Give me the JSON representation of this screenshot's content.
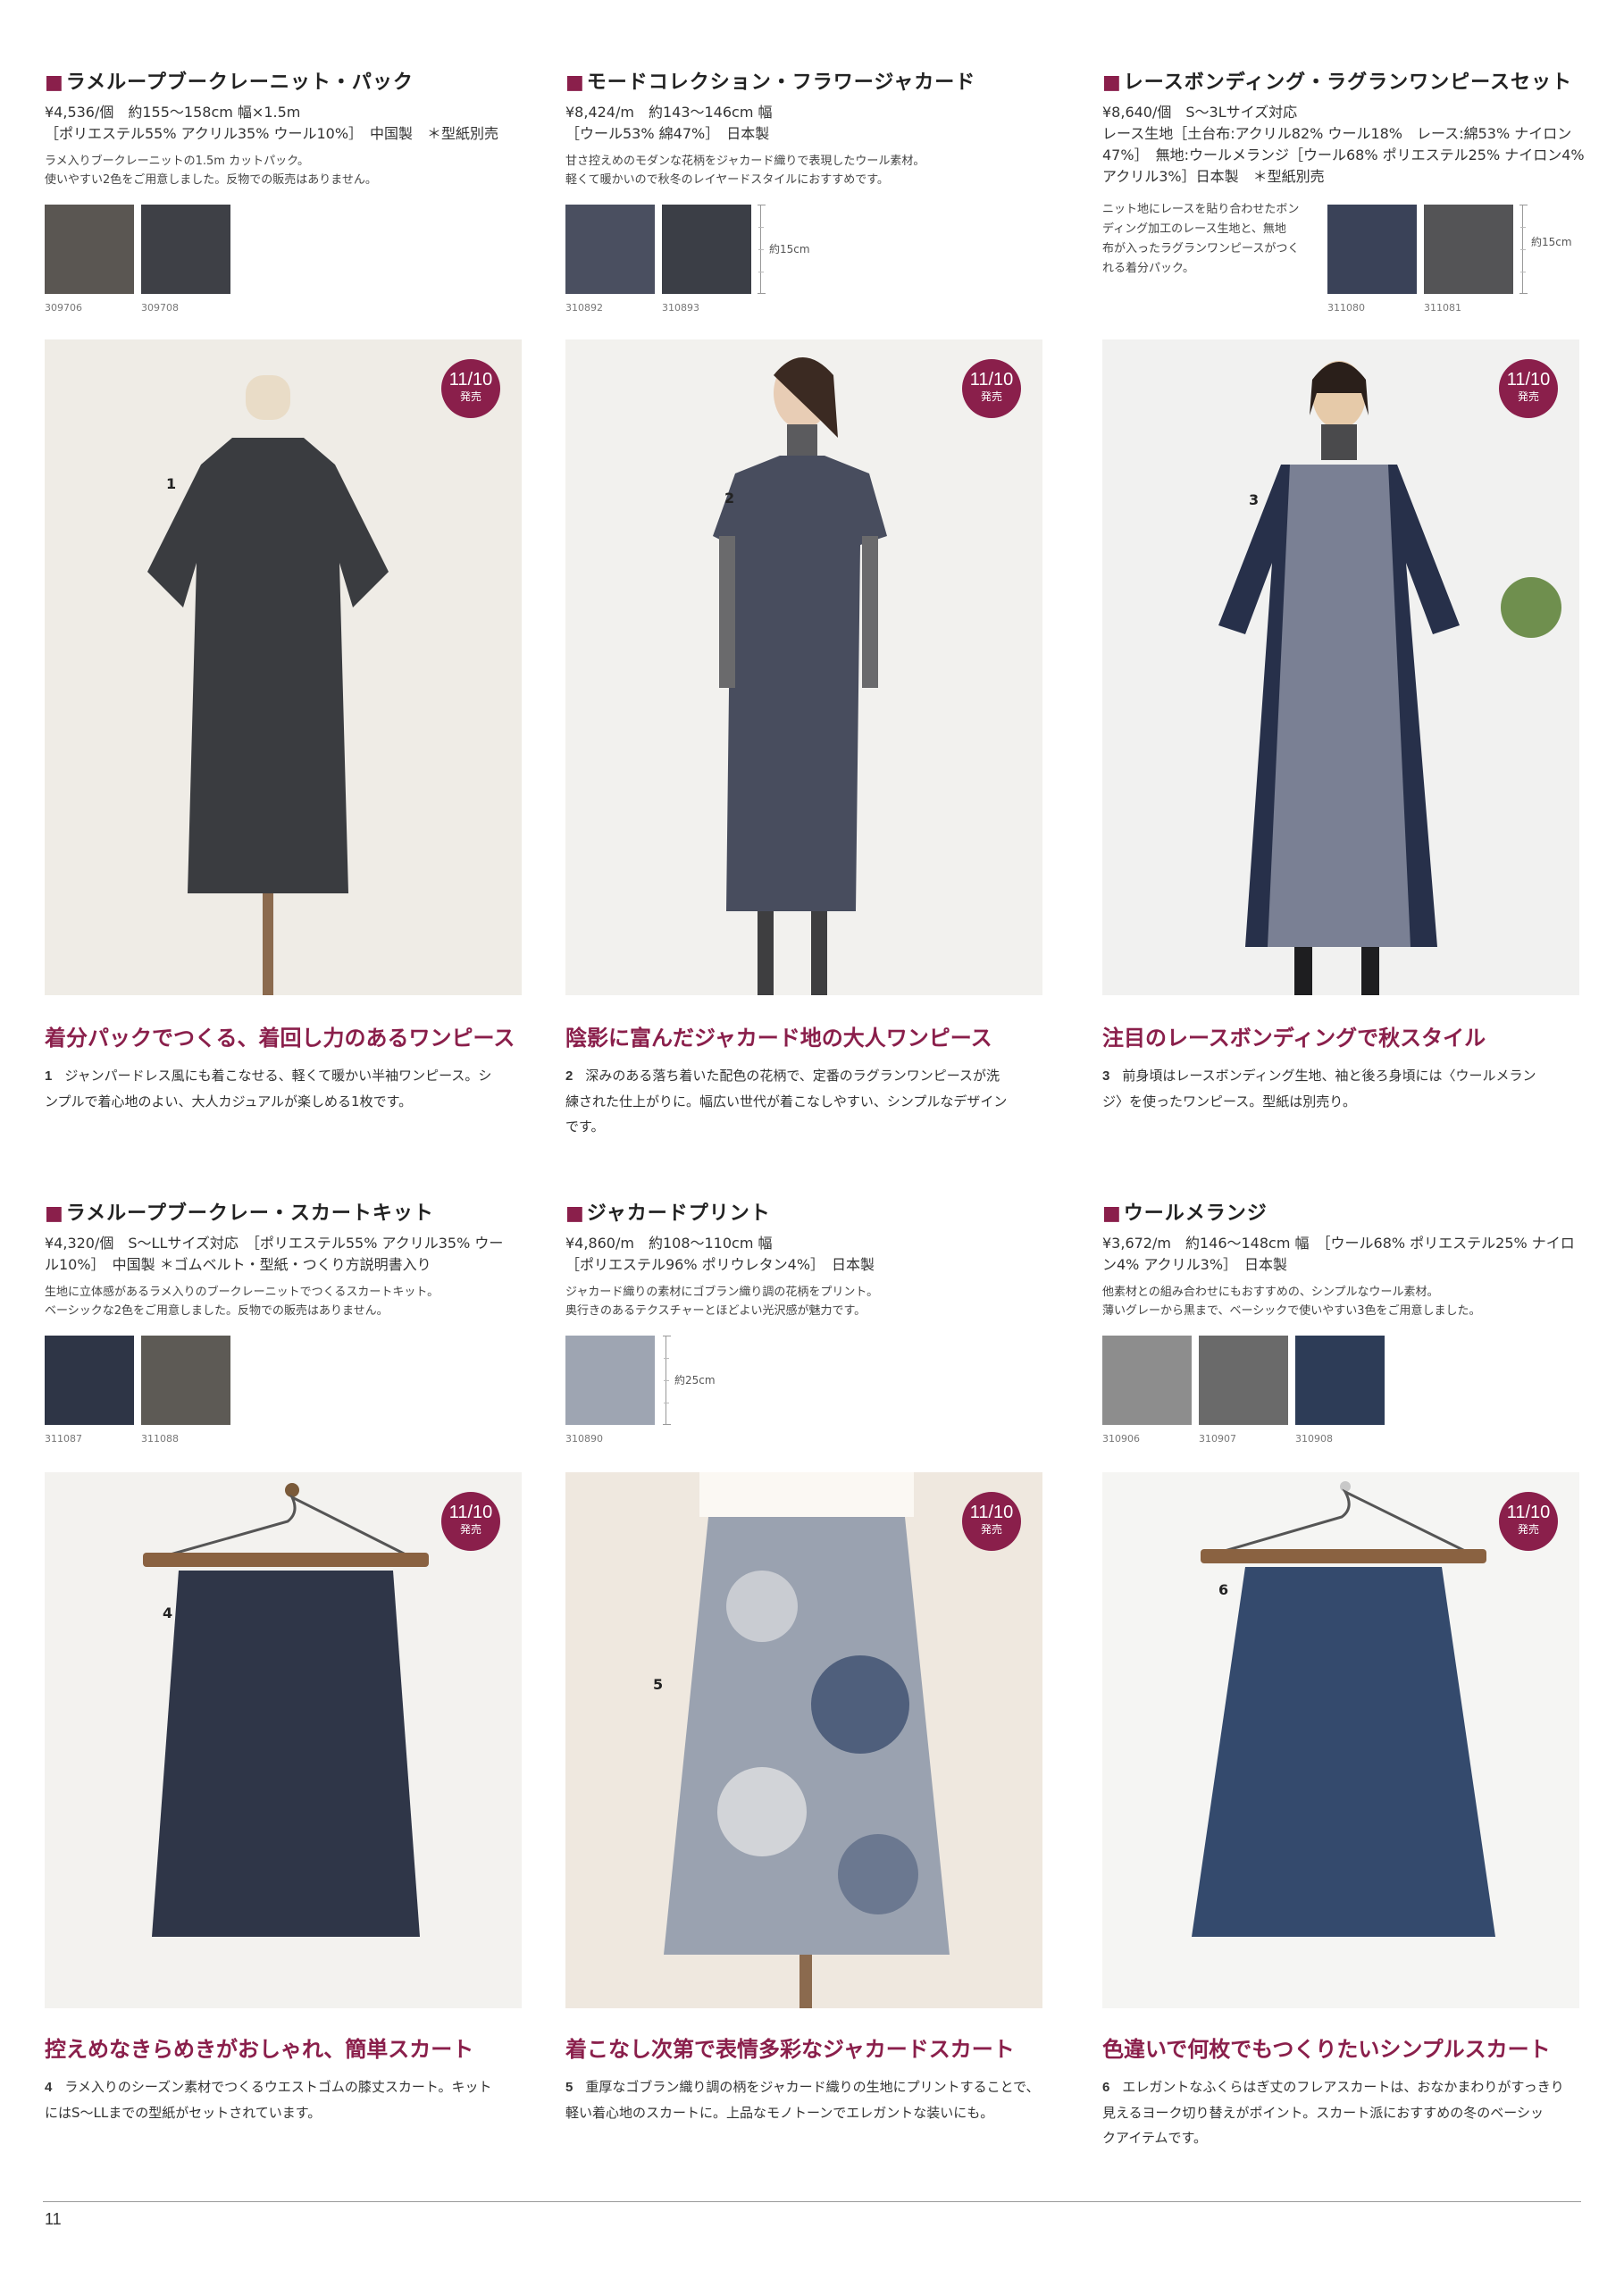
{
  "products": [
    {
      "title": "ラメループブークレーニット・パック",
      "specs": [
        "¥4,536/個　約155～158cm 幅×1.5m",
        "［ポリエステル55% アクリル35% ウール10%］　中国製　＊型紙別売"
      ],
      "desc": [
        "ラメ入りブークレーニットの1.5m カットパック。",
        "使いやすい2色をご用意しました。反物での販売はありません。"
      ],
      "swatches": [
        {
          "code": "309706",
          "color": "#5a5652"
        },
        {
          "code": "309708",
          "color": "#3e4046"
        }
      ],
      "ruler": "",
      "badge": {
        "date": "11/10",
        "label": "発売"
      },
      "photo_number": "1",
      "headline": "着分パックでつくる、着回し力のあるワンピース",
      "caption_number": "1",
      "caption": [
        "ジャンパードレス風にも着こなせる、軽くて暖かい半袖ワンピース。シ",
        "ンプルで着心地のよい、大人カジュアルが楽しめる1枚です。"
      ]
    },
    {
      "title": "モードコレクション・フラワージャカード",
      "specs": [
        "¥8,424/m　約143～146cm 幅",
        "［ウール53% 綿47%］　日本製"
      ],
      "desc": [
        "甘さ控えめのモダンな花柄をジャカード織りで表現したウール素材。",
        "軽くて暖かいので秋冬のレイヤードスタイルにおすすめです。"
      ],
      "swatches": [
        {
          "code": "310892",
          "color": "#4a4f60"
        },
        {
          "code": "310893",
          "color": "#3b3e46"
        }
      ],
      "ruler": "約15cm",
      "badge": {
        "date": "11/10",
        "label": "発売"
      },
      "photo_number": "2",
      "headline": "陰影に富んだジャカード地の大人ワンピース",
      "caption_number": "2",
      "caption": [
        "深みのある落ち着いた配色の花柄で、定番のラグランワンピースが洗",
        "練された仕上がりに。幅広い世代が着こなしやすい、シンプルなデザイン",
        "です。"
      ]
    },
    {
      "title": "レースボンディング・ラグランワンピースセット",
      "specs": [
        "¥8,640/個　S～3Lサイズ対応",
        "レース生地［土台布:アクリル82% ウール18%　レース:綿53% ナイロン",
        "47%］　無地:ウールメランジ［ウール68% ポリエステル25% ナイロン4%",
        "アクリル3%］日本製　＊型紙別売"
      ],
      "desc": [
        "ニット地にレースを貼り合わせたボン",
        "ディング加工のレース生地と、無地",
        "布が入ったラグランワンピースがつく",
        "れる着分パック。"
      ],
      "swatches": [
        {
          "code": "311080",
          "color": "#3a4258"
        },
        {
          "code": "311081",
          "color": "#545456"
        }
      ],
      "ruler": "約15cm",
      "badge": {
        "date": "11/10",
        "label": "発売"
      },
      "photo_number": "3",
      "headline": "注目のレースボンディングで秋スタイル",
      "caption_number": "3",
      "caption": [
        "前身頃はレースボンディング生地、袖と後ろ身頃には〈ウールメラン",
        "ジ〉を使ったワンピース。型紙は別売り。"
      ]
    },
    {
      "title": "ラメループブークレー・スカートキット",
      "specs": [
        "¥4,320/個　S～LLサイズ対応　［ポリエステル55% アクリル35% ウー",
        "ル10%］　中国製 ＊ゴムベルト・型紙・つくり方説明書入り"
      ],
      "desc": [
        "生地に立体感があるラメ入りのブークレーニットでつくるスカートキット。",
        "ベーシックな2色をご用意しました。反物での販売はありません。"
      ],
      "swatches": [
        {
          "code": "311087",
          "color": "#2e3546"
        },
        {
          "code": "311088",
          "color": "#5d5a55"
        }
      ],
      "ruler": "",
      "badge": {
        "date": "11/10",
        "label": "発売"
      },
      "photo_number": "4",
      "headline": "控えめなきらめきがおしゃれ、簡単スカート",
      "caption_number": "4",
      "caption": [
        "ラメ入りのシーズン素材でつくるウエストゴムの膝丈スカート。キット",
        "にはS～LLまでの型紙がセットされています。"
      ]
    },
    {
      "title": "ジャカードプリント",
      "specs": [
        "¥4,860/m　約108～110cm 幅",
        "［ポリエステル96% ポリウレタン4%］　日本製"
      ],
      "desc": [
        "ジャカード織りの素材にゴブラン織り調の花柄をプリント。",
        "奥行きのあるテクスチャーとほどよい光沢感が魅力です。"
      ],
      "swatches": [
        {
          "code": "310890",
          "color": "#9ea5b2"
        }
      ],
      "ruler": "約25cm",
      "badge": {
        "date": "11/10",
        "label": "発売"
      },
      "photo_number": "5",
      "headline": "着こなし次第で表情多彩なジャカードスカート",
      "caption_number": "5",
      "caption": [
        "重厚なゴブラン織り調の柄をジャカード織りの生地にプリントすることで、",
        "軽い着心地のスカートに。上品なモノトーンでエレガントな装いにも。"
      ]
    },
    {
      "title": "ウールメランジ",
      "specs": [
        "¥3,672/m　約146～148cm 幅　［ウール68% ポリエステル25% ナイロ",
        "ン4% アクリル3%］　日本製"
      ],
      "desc": [
        "他素材との組み合わせにもおすすめの、シンプルなウール素材。",
        "薄いグレーから黒まで、ベーシックで使いやすい3色をご用意しました。"
      ],
      "swatches": [
        {
          "code": "310906",
          "color": "#8d8d8d"
        },
        {
          "code": "310907",
          "color": "#6a6a6a"
        },
        {
          "code": "310908",
          "color": "#2d3c57"
        }
      ],
      "ruler": "",
      "badge": {
        "date": "11/10",
        "label": "発売"
      },
      "photo_number": "6",
      "headline": "色違いで何枚でもつくりたいシンプルスカート",
      "caption_number": "6",
      "caption": [
        "エレガントなふくらはぎ丈のフレアスカートは、おなかまわりがすっきり",
        "見えるヨーク切り替えがポイント。スカート派におすすめの冬のベーシッ",
        "クアイテムです。"
      ]
    }
  ],
  "page_number": "11",
  "colors": {
    "accent": "#8a1f4b",
    "text": "#333333"
  }
}
